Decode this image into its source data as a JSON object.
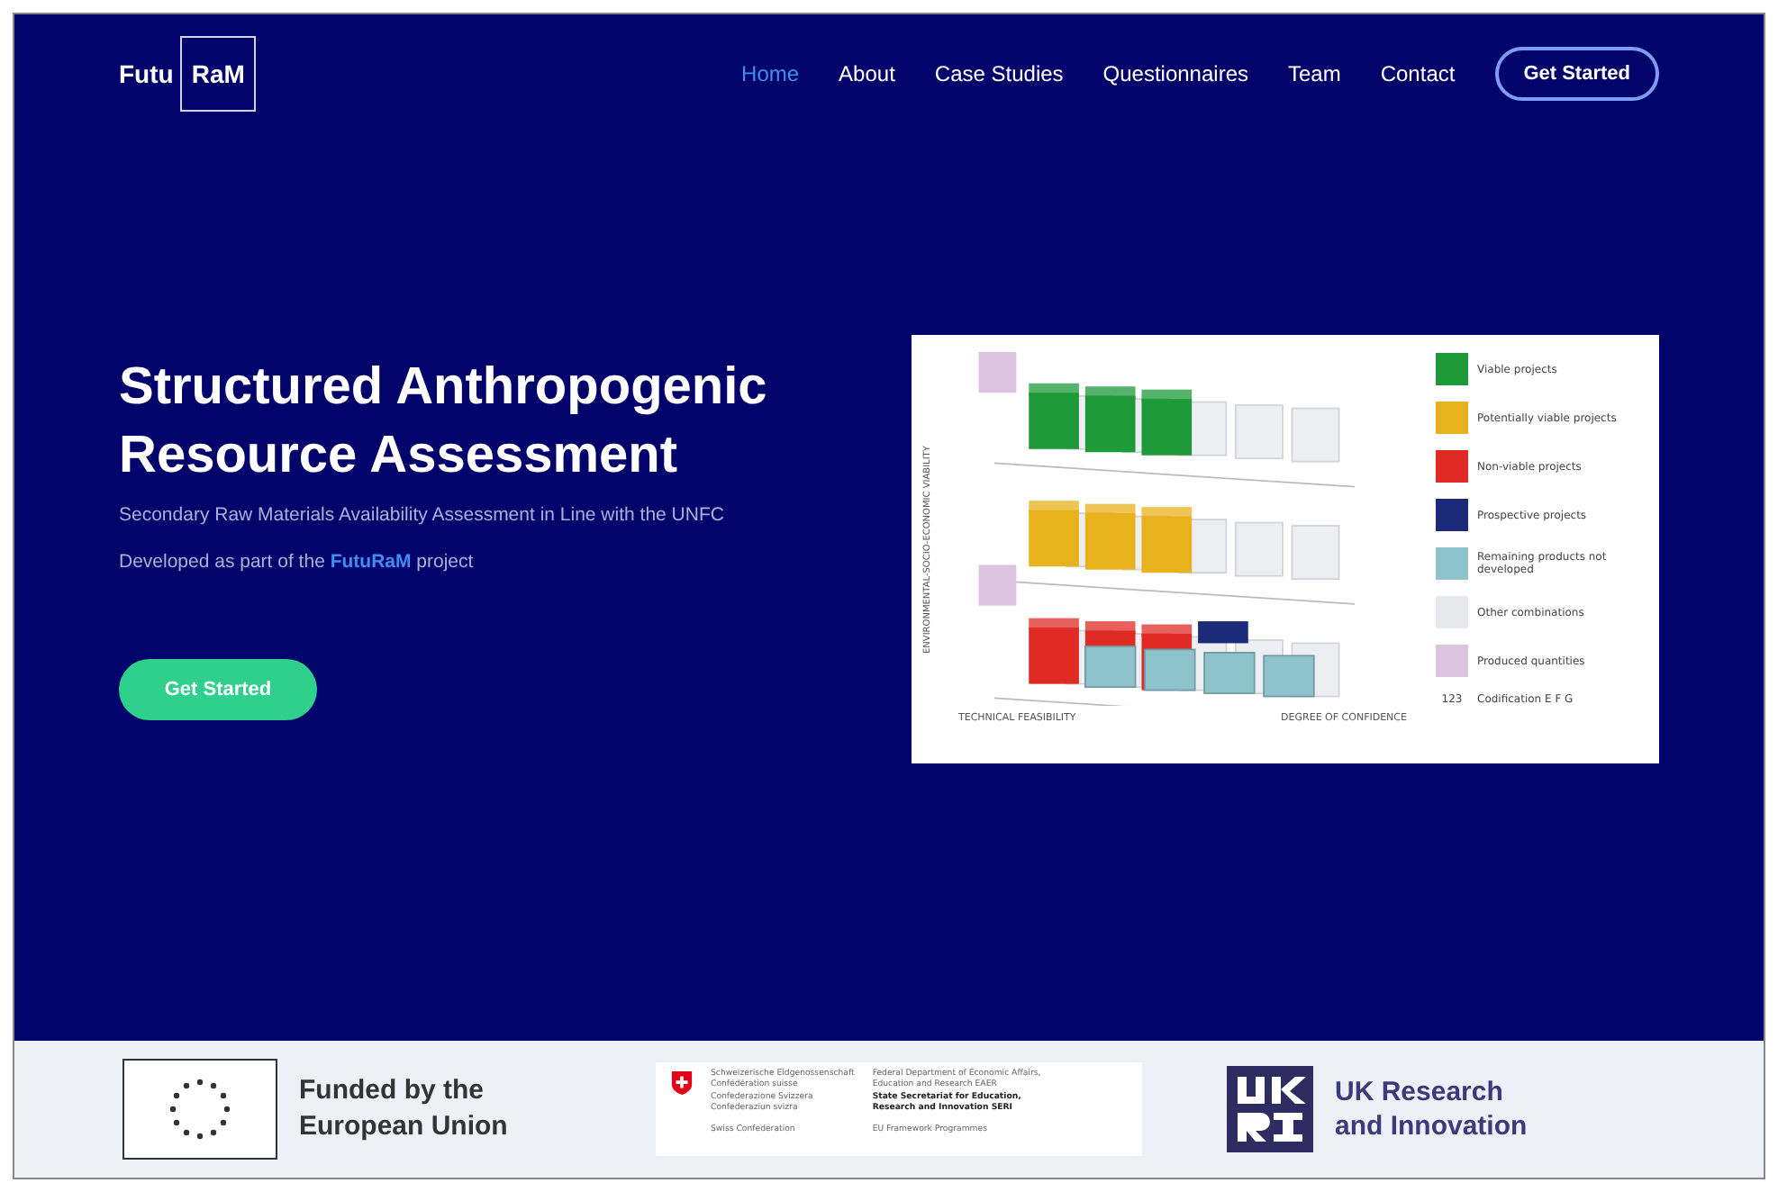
{
  "logo": {
    "left": "Futu",
    "right": "RaM"
  },
  "nav": [
    {
      "label": "Home",
      "selected": true
    },
    {
      "label": "About",
      "selected": false
    },
    {
      "label": "Case Studies",
      "selected": false
    },
    {
      "label": "Questionnaires",
      "selected": false
    },
    {
      "label": "Team",
      "selected": false
    },
    {
      "label": "Contact",
      "selected": false
    }
  ],
  "nav_button": "Get Started",
  "hero": {
    "title": "Structured Anthropogenic Resource Assessment",
    "subtitle": "Secondary Raw Materials Availability Assessment in Line with the UNFC",
    "note": "Developed as part of the **FutuRaM** project",
    "button": "Get Started"
  },
  "figure": {
    "y_axis": "ENVIRONMENTAL-SOCIO-ECONOMIC VIABILITY",
    "x_axis": "DEGREE OF CONFIDENCE",
    "z_axis": "TECHNICAL FEASIBILITY",
    "legend": [
      {
        "label": "Viable projects",
        "color": "#1f9a3a"
      },
      {
        "label": "Potentially viable projects",
        "color": "#e8b21c"
      },
      {
        "label": "Non-viable projects",
        "color": "#e02b25"
      },
      {
        "label": "Prospective projects",
        "color": "#1c2a7a"
      },
      {
        "label": "Remaining products not developed",
        "color": "#8fc3cc"
      },
      {
        "label": "Other combinations",
        "color": "#e8e9ec"
      },
      {
        "label": "Produced quantities",
        "color": "#dcc3e0"
      }
    ],
    "code_label": "123",
    "code_text": "Codification E F G"
  },
  "footer": {
    "eu_text": "Funded by the European Union",
    "swiss_left": [
      "Schweizerische Eidgenossenschaft",
      "Confédération suisse",
      "Confederazione Svizzera",
      "Confederaziun svizra"
    ],
    "swiss_left_bottom": "Swiss Confederation",
    "swiss_right": [
      "Federal Department of Economic Affairs,",
      "Education and Research EAER"
    ],
    "swiss_right_bold": [
      "State Secretariat for Education,",
      "Research and Innovation SERI"
    ],
    "swiss_right_bottom": "EU Framework Programmes",
    "ukri_text": "UK Research and Innovation"
  }
}
